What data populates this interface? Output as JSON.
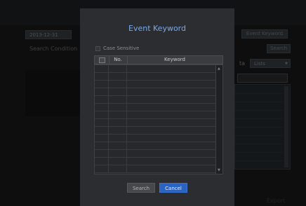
{
  "background": {
    "date_value": "2013-12-31",
    "search_condition_label": "Search Condition",
    "event_keyword_button": "Event Keyword",
    "search_button": "Search",
    "data_label": "ta",
    "data_select_value": "Lists",
    "export_button": "Export"
  },
  "dialog": {
    "title": "Event Keyword",
    "case_sensitive_label": "Case Sensitive",
    "columns": {
      "no": "No.",
      "keyword": "Keyword"
    },
    "rows": [
      "",
      "",
      "",
      "",
      "",
      "",
      "",
      "",
      "",
      "",
      "",
      "",
      "",
      ""
    ],
    "buttons": {
      "search": "Search",
      "cancel": "Cancel"
    }
  },
  "colors": {
    "title": "#7aa8e8",
    "primary_button": "#2b63c0",
    "dialog_bg": "#2b2d30"
  },
  "icons": {
    "scroll_up": "▲",
    "scroll_down": "▼"
  }
}
